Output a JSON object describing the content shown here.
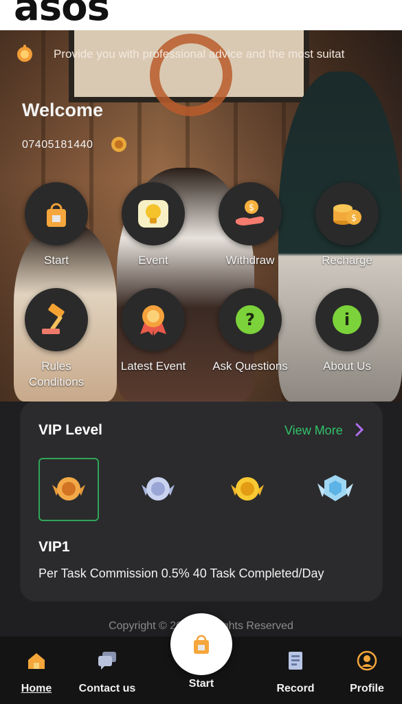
{
  "header": {
    "logo": "asos"
  },
  "hero": {
    "notice": "Provide you with professional advice and the most suitat",
    "welcome": "Welcome",
    "phone": "07405181440"
  },
  "grid": [
    {
      "label": "Start",
      "icon": "shopping-bag-icon"
    },
    {
      "label": "Event",
      "icon": "lightbulb-icon"
    },
    {
      "label": "Withdraw",
      "icon": "coin-hand-icon"
    },
    {
      "label": "Recharge",
      "icon": "coins-icon"
    },
    {
      "label": "Rules\nConditions",
      "icon": "gavel-icon"
    },
    {
      "label": "Latest Event",
      "icon": "medal-icon"
    },
    {
      "label": "Ask Questions",
      "icon": "question-icon"
    },
    {
      "label": "About Us",
      "icon": "info-icon"
    }
  ],
  "vip": {
    "title": "VIP Level",
    "view_more": "View More",
    "level_name": "VIP1",
    "description": "Per Task Commission 0.5% 40 Task Completed/Day",
    "badges": [
      "bronze-badge-icon",
      "silver-badge-icon",
      "gold-badge-icon",
      "diamond-badge-icon"
    ],
    "selected_index": 0
  },
  "footer": {
    "copyright": "Copyright © 2022 All Rights Reserved"
  },
  "nav": {
    "home": "Home",
    "contact": "Contact us",
    "start": "Start",
    "record": "Record",
    "profile": "Profile"
  },
  "colors": {
    "accent_green": "#31c26a",
    "card_bg": "#2b2b2d",
    "nav_bg": "#141414"
  }
}
